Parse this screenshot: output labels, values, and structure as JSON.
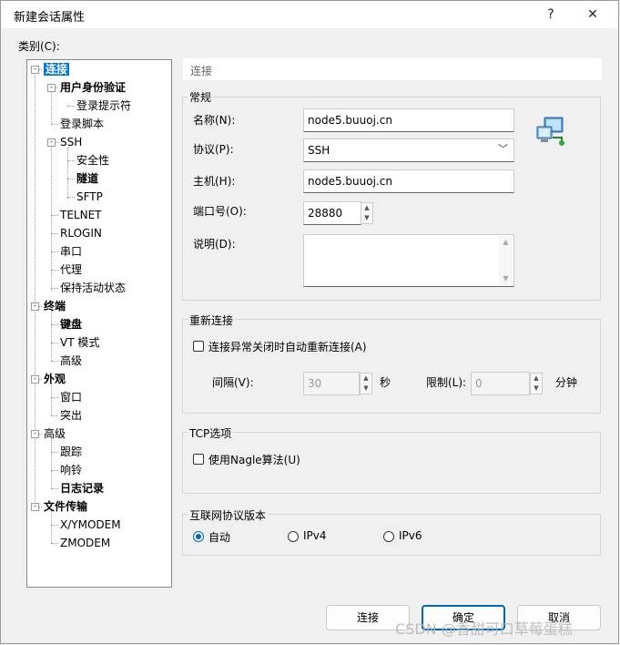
{
  "window": {
    "title": "新建会话属性",
    "help_button": "?",
    "close_button": "✕"
  },
  "category_label": "类别(C):",
  "tree": [
    {
      "label": "连接",
      "bold": true,
      "selected": true
    },
    {
      "label": "用户身份验证",
      "bold": true
    },
    {
      "label": "登录提示符",
      "bold": false
    },
    {
      "label": "登录脚本",
      "bold": false
    },
    {
      "label": "SSH",
      "bold": false
    },
    {
      "label": "安全性",
      "bold": false
    },
    {
      "label": "隧道",
      "bold": true
    },
    {
      "label": "SFTP",
      "bold": false
    },
    {
      "label": "TELNET",
      "bold": false
    },
    {
      "label": "RLOGIN",
      "bold": false
    },
    {
      "label": "串口",
      "bold": false
    },
    {
      "label": "代理",
      "bold": false
    },
    {
      "label": "保持活动状态",
      "bold": false
    },
    {
      "label": "终端",
      "bold": true
    },
    {
      "label": "键盘",
      "bold": true
    },
    {
      "label": "VT 模式",
      "bold": false
    },
    {
      "label": "高级",
      "bold": false
    },
    {
      "label": "外观",
      "bold": true
    },
    {
      "label": "窗口",
      "bold": false
    },
    {
      "label": "突出",
      "bold": false
    },
    {
      "label": "高级",
      "bold": false
    },
    {
      "label": "跟踪",
      "bold": false
    },
    {
      "label": "响铃",
      "bold": false
    },
    {
      "label": "日志记录",
      "bold": true
    },
    {
      "label": "文件传输",
      "bold": true
    },
    {
      "label": "X/YMODEM",
      "bold": false
    },
    {
      "label": "ZMODEM",
      "bold": false
    }
  ],
  "panel_header": "连接",
  "general": {
    "title": "常规",
    "name_label": "名称(N):",
    "name_value": "node5.buuoj.cn",
    "protocol_label": "协议(P):",
    "protocol_value": "SSH",
    "host_label": "主机(H):",
    "host_value": "node5.buuoj.cn",
    "port_label": "端口号(O):",
    "port_value": "28880",
    "desc_label": "说明(D):",
    "desc_value": ""
  },
  "reconnect": {
    "title": "重新连接",
    "checkbox_label": "连接异常关闭时自动重新连接(A)",
    "interval_label": "间隔(V):",
    "interval_value": "30",
    "interval_unit": "秒",
    "limit_label": "限制(L):",
    "limit_value": "0",
    "limit_unit": "分钟"
  },
  "tcp": {
    "title": "TCP选项",
    "nagle_label": "使用Nagle算法(U)"
  },
  "ip_version": {
    "title": "互联网协议版本",
    "options": [
      "自动",
      "IPv4",
      "IPv6"
    ],
    "selected": "自动"
  },
  "buttons": {
    "connect": "连接",
    "ok": "确定",
    "cancel": "取消"
  },
  "watermark": "CSDN @香甜可口草莓蛋糕"
}
